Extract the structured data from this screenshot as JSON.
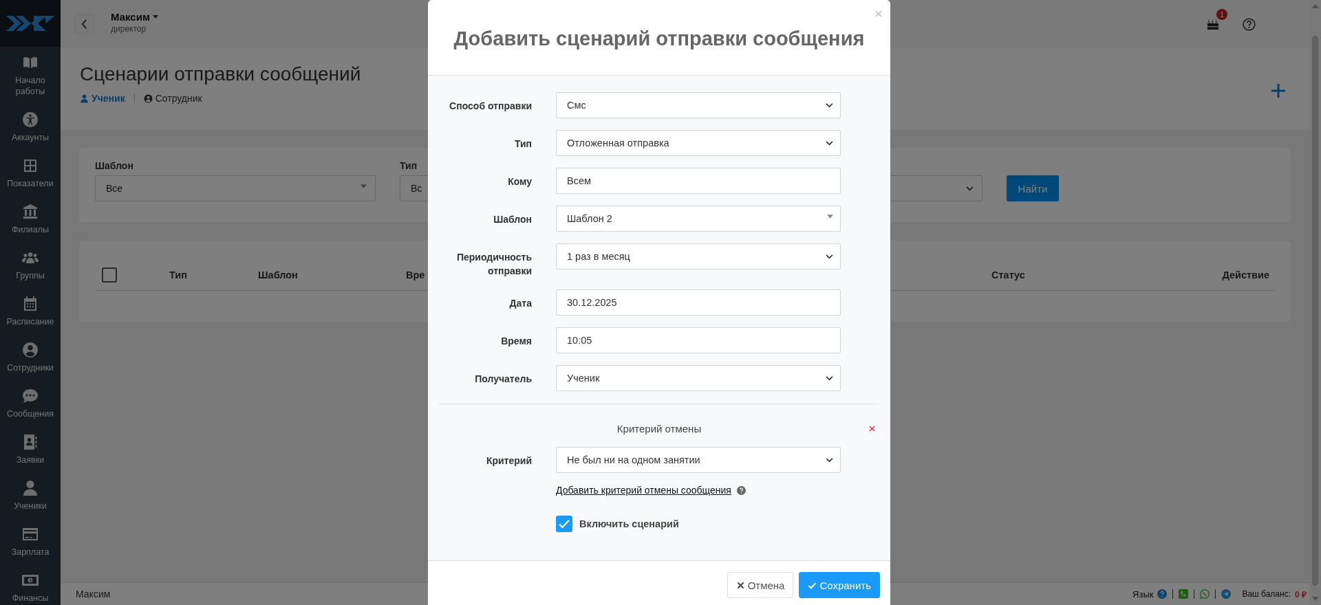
{
  "sidebar": {
    "items": [
      {
        "label": "Начало работы"
      },
      {
        "label": "Аккаунты"
      },
      {
        "label": "Показатели"
      },
      {
        "label": "Филиалы"
      },
      {
        "label": "Группы"
      },
      {
        "label": "Расписание"
      },
      {
        "label": "Сотрудники"
      },
      {
        "label": "Сообщения"
      },
      {
        "label": "Заявки"
      },
      {
        "label": "Ученики"
      },
      {
        "label": "Зарплата"
      },
      {
        "label": "Финансы"
      }
    ]
  },
  "header": {
    "user_name": "Максим",
    "user_role": "директор",
    "notification_count": "1"
  },
  "page": {
    "title": "Сценарии отправки сообщений",
    "tabs": [
      {
        "label": "Ученик",
        "selected": true
      },
      {
        "label": "Сотрудник",
        "selected": false
      }
    ]
  },
  "filters": {
    "fields": [
      {
        "label": "Шаблон",
        "value": "Все",
        "kind": "select2"
      },
      {
        "label": "Тип",
        "value": "Вс"
      },
      {
        "kind": "select"
      }
    ],
    "search_button": "Найти"
  },
  "table": {
    "select_all_checked": false,
    "columns": [
      "Тип",
      "Шаблон",
      "Вре",
      "Статус",
      "Действие"
    ]
  },
  "footer": {
    "user_name": "Максим",
    "language_label": "Язык",
    "balance_label": "Ваш баланс:",
    "balance_value": "0 ₽"
  },
  "modal": {
    "title": "Добавить сценарий отправки сообщения",
    "fields": [
      {
        "label": "Способ отправки",
        "value": "Смс",
        "kind": "select"
      },
      {
        "label": "Тип",
        "value": "Отложенная отправка",
        "kind": "select"
      },
      {
        "label": "Кому",
        "value": "Всем",
        "kind": "input"
      },
      {
        "label": "Шаблон",
        "value": "Шаблон 2",
        "kind": "select2"
      },
      {
        "label": "Периодичность отправки",
        "value": "1 раз в месяц",
        "kind": "select"
      },
      {
        "label": "Дата",
        "value": "30.12.2025",
        "kind": "input"
      },
      {
        "label": "Время",
        "value": "10:05",
        "kind": "input"
      },
      {
        "label": "Получатель",
        "value": "Ученик",
        "kind": "select"
      }
    ],
    "cancel_section": {
      "title": "Критерий отмены",
      "fields": [
        {
          "label": "Критерий",
          "value": "Не был ни на одном занятии",
          "kind": "select"
        }
      ],
      "add_link": "Добавить критерий отмены сообщения"
    },
    "enable": {
      "label": "Включить сценарий",
      "checked": true
    },
    "buttons": [
      {
        "label": "Отмена",
        "kind": "cancel"
      },
      {
        "label": "Сохранить",
        "kind": "primary"
      }
    ]
  }
}
